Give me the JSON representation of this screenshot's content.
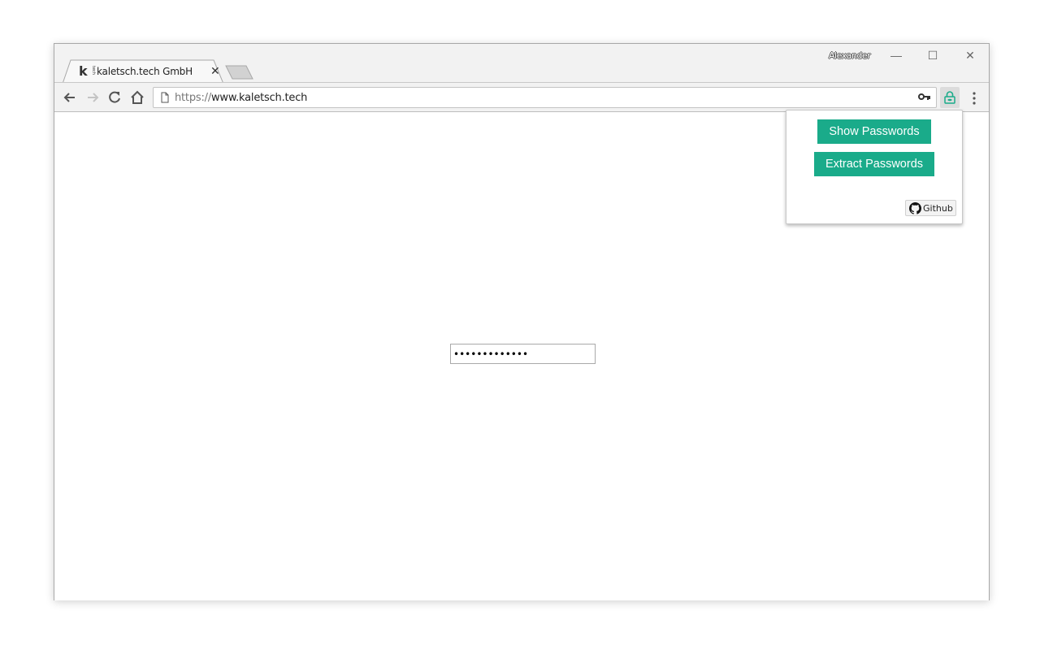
{
  "window": {
    "profile_name": "Alexander",
    "controls": {
      "minimize": "—",
      "maximize": "☐",
      "close": "✕"
    }
  },
  "tabs": [
    {
      "title": "kaletsch.tech GmbH",
      "favicon": "k",
      "favicon_sub": "tech",
      "close": "✕",
      "active": true
    }
  ],
  "toolbar": {
    "url_scheme": "https://",
    "url_host": "www.kaletsch.tech",
    "icons": [
      "back-arrow-icon",
      "forward-arrow-icon",
      "reload-icon",
      "home-icon",
      "page-icon",
      "key-icon",
      "extension-lock-icon",
      "menu-dots-icon"
    ]
  },
  "page": {
    "password_value": "•••••••••••••"
  },
  "popup": {
    "show_label": "Show Passwords",
    "extract_label": "Extract Passwords",
    "github_label": "Github",
    "accent": "#1aab8a"
  }
}
